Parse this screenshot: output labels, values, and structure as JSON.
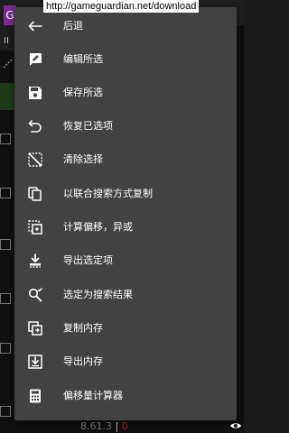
{
  "url_tooltip": "http://gameguardian.net/download",
  "background": {
    "app_icon_letter": "G",
    "pause_glyph": "II"
  },
  "menu": {
    "items": [
      {
        "label": "后退",
        "icon": "back-arrow-icon"
      },
      {
        "label": "编辑所选",
        "icon": "edit-icon"
      },
      {
        "label": "保存所选",
        "icon": "save-icon"
      },
      {
        "label": "恢复已选项",
        "icon": "undo-icon"
      },
      {
        "label": "清除选择",
        "icon": "clear-selection-icon"
      },
      {
        "label": "以联合搜索方式复制",
        "icon": "copy-icon"
      },
      {
        "label": "计算偏移，异或",
        "icon": "offset-calc-icon"
      },
      {
        "label": "导出选定项",
        "icon": "export-selected-icon"
      },
      {
        "label": "选定为搜索结果",
        "icon": "search-result-icon"
      },
      {
        "label": "复制内存",
        "icon": "copy-memory-icon"
      },
      {
        "label": "导出内存",
        "icon": "export-memory-icon"
      },
      {
        "label": "偏移量计算器",
        "icon": "calculator-icon"
      }
    ]
  },
  "status": {
    "version": "8.61.3",
    "separator": "|",
    "count": "0"
  },
  "colors": {
    "menu_background": "#424242",
    "menu_text": "#ffffff",
    "status_count": "#a31515"
  }
}
